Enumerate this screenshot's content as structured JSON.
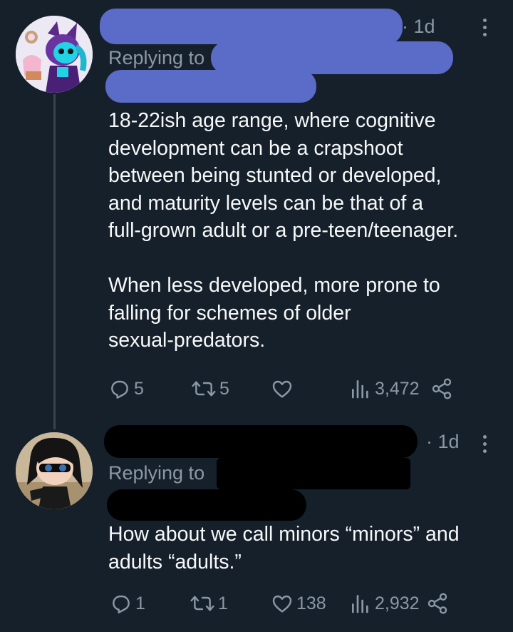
{
  "tweets": [
    {
      "time": "· 1d",
      "replying_label": "Replying to",
      "body": "18-22ish age range, where cognitive\ndevelopment can be a crapshoot\nbetween being stunted or developed,\nand maturity levels can be that of a\nfull-grown adult or a pre-teen/teenager.\n\nWhen less developed, more prone to\nfalling for schemes of older\nsexual-predators.",
      "replies": "5",
      "retweets": "5",
      "likes": "",
      "views": "3,472",
      "redaction_color": "#5a6bc8"
    },
    {
      "time": "· 1d",
      "replying_label": "Replying to",
      "body": "How about we call minors “minors” and\nadults “adults.”",
      "replies": "1",
      "retweets": "1",
      "likes": "138",
      "views": "2,932",
      "redaction_color": "#000000"
    }
  ],
  "icons": [
    "reply-icon",
    "retweet-icon",
    "like-icon",
    "views-icon",
    "share-icon",
    "more-icon"
  ]
}
